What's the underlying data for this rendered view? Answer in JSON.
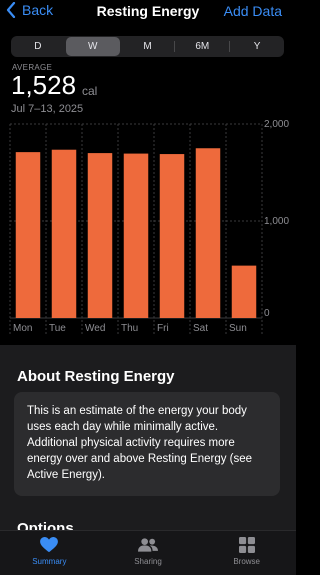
{
  "nav": {
    "back_label": "Back",
    "title": "Resting Energy",
    "add_label": "Add Data"
  },
  "segments": [
    {
      "label": "D",
      "selected": false
    },
    {
      "label": "W",
      "selected": true
    },
    {
      "label": "M",
      "selected": false
    },
    {
      "label": "6M",
      "selected": false
    },
    {
      "label": "Y",
      "selected": false
    }
  ],
  "summary": {
    "label": "AVERAGE",
    "value": "1,528",
    "unit": "cal",
    "date_range": "Jul 7–13, 2025"
  },
  "chart_data": {
    "type": "bar",
    "categories": [
      "Mon",
      "Tue",
      "Wed",
      "Thu",
      "Fri",
      "Sat",
      "Sun"
    ],
    "values": [
      1710,
      1735,
      1700,
      1695,
      1690,
      1750,
      540
    ],
    "yticks": [
      {
        "value": 2000,
        "label": "2,000"
      },
      {
        "value": 1000,
        "label": "1,000"
      },
      {
        "value": 0,
        "label": "0"
      }
    ],
    "ylim": [
      0,
      2000
    ],
    "bar_color": "#ee6a3c",
    "grid": true
  },
  "about": {
    "title": "About Resting Energy",
    "text": "This is an estimate of the energy your body uses each day while minimally active. Additional physical activity requires more energy over and above Resting Energy (see Active Energy)."
  },
  "options_title": "Options",
  "tabbar": [
    {
      "label": "Summary",
      "icon": "heart-icon",
      "active": true
    },
    {
      "label": "Sharing",
      "icon": "people-icon",
      "active": false
    },
    {
      "label": "Browse",
      "icon": "grid-icon",
      "active": false
    }
  ],
  "colors": {
    "accent": "#3a8df5",
    "bar": "#ee6a3c"
  }
}
